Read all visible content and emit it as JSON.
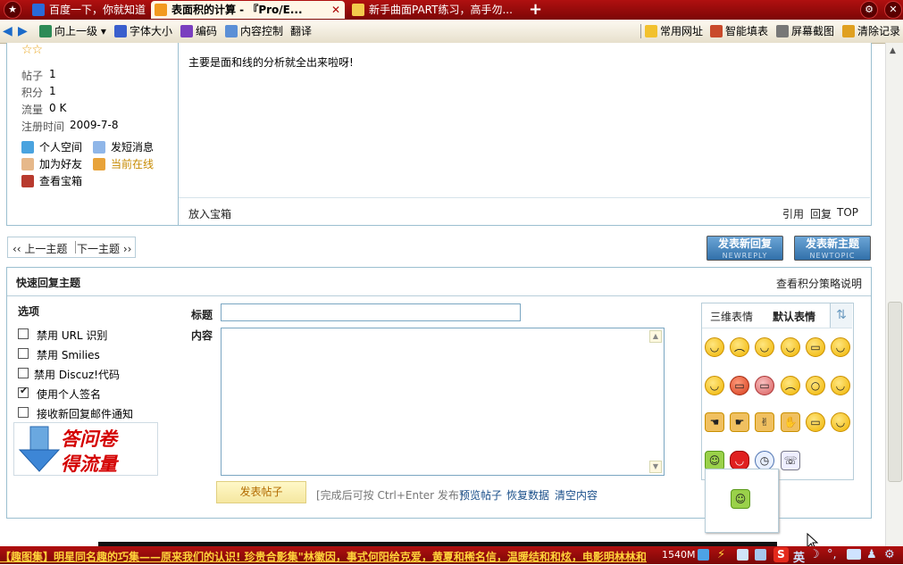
{
  "browser": {
    "tabs": [
      {
        "label": "百度一下，你就知道",
        "active": false
      },
      {
        "label": "表面积的计算 -  『Pro/E...",
        "active": true
      },
      {
        "label": "新手曲面PART练习，高手勿...",
        "active": false
      }
    ],
    "new_tab_glyph": "+",
    "toolbar": {
      "up_level": "向上一级",
      "font_size": "字体大小",
      "encoding": "编码",
      "content_control": "内容控制",
      "translate": "翻译",
      "common_sites": "常用网址",
      "smart_fill": "智能填表",
      "screenshot": "屏幕截图",
      "clear_history": "清除记录"
    },
    "status": {
      "ticker": "【趣图集】明星同名趣的巧集——原来我们的认识! 珍贵合影集\"林徽因，事式何阳给克爱，黄夏和稀名信，温暖结和和炫，电影明林林和",
      "memory": "1540M",
      "ime": "英"
    }
  },
  "post": {
    "stars": "☆☆",
    "stats": [
      {
        "label": "帖子",
        "value": "1"
      },
      {
        "label": "积分",
        "value": "1"
      },
      {
        "label": "流量",
        "value": "0 K"
      },
      {
        "label": "注册时间",
        "value": "2009-7-8"
      }
    ],
    "actions": {
      "personal_space": "个人空间",
      "send_message": "发短消息",
      "add_friend": "加为好友",
      "online": "当前在线",
      "view_box": "查看宝箱"
    },
    "body": "主要是面和线的分析就全出来啦呀!",
    "put_box": "放入宝箱",
    "quote": "引用",
    "reply": "回复",
    "top": "TOP"
  },
  "nav": {
    "prev_topic": "‹‹ 上一主题",
    "next_topic": "下一主题 ››",
    "new_reply_label": "发表新回复",
    "new_reply_sub": "NEWREPLY",
    "new_topic_label": "发表新主题",
    "new_topic_sub": "NEWTOPIC"
  },
  "quick_reply": {
    "title": "快速回复主题",
    "policy_link": "查看积分策略说明",
    "options_title": "选项",
    "options": [
      {
        "label": "禁用  URL 识别",
        "checked": false
      },
      {
        "label": "禁用  Smilies",
        "checked": false
      },
      {
        "label": "禁用  Discuz!代码",
        "checked": false
      },
      {
        "label": "使用个人签名",
        "checked": true
      },
      {
        "label": "接收新回复邮件通知",
        "checked": false
      }
    ],
    "banner_line1": "答问卷",
    "banner_line2": "得流量",
    "subject_label": "标题",
    "subject_value": "",
    "content_label": "内容",
    "content_value": "",
    "submit": "发表帖子",
    "hint": "[完成后可按  Ctrl+Enter 发布]",
    "preview": "预览帖子",
    "restore": "恢复数据",
    "clear": "清空内容",
    "emoji_tab_3d": "三维表情",
    "emoji_tab_default": "默认表情"
  }
}
